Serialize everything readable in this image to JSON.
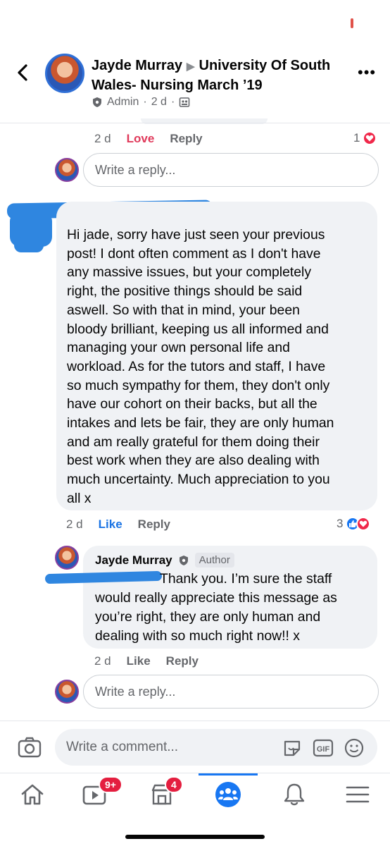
{
  "header": {
    "author": "Jayde Murray",
    "group": "University Of South Wales- Nursing March ’19",
    "role": "Admin",
    "time": "2 d",
    "more": "•••"
  },
  "first_actions": {
    "time": "2 d",
    "love": "Love",
    "reply": "Reply",
    "reaction_count": "1"
  },
  "reply_box_1": {
    "placeholder": "Write a reply..."
  },
  "comment": {
    "lines": [
      "Hi jade, sorry have just seen your previous",
      "post! I dont often comment as I don't have",
      "any massive issues, but your completely",
      "right, the positive things should be said",
      "aswell. So with that in mind, your been",
      "bloody brilliant, keeping us all informed and",
      "managing your own personal life and",
      "workload. As for the tutors and staff, I have",
      "so much sympathy for them, they don't only",
      "have our cohort on their backs, but all the",
      "intakes and lets be fair, they are only human",
      "and am really grateful for them doing their",
      "best work when they are also dealing with",
      "much uncertainty. Much appreciation to you",
      "all x"
    ],
    "time": "2 d",
    "like": "Like",
    "reply": "Reply",
    "reaction_count": "3"
  },
  "reply": {
    "author": "Jayde Murray",
    "badge": "Author",
    "lines": [
      "Thank you. I’m sure the staff",
      "would really appreciate this message as",
      "you’re right, they are only human and",
      "dealing with so much right now!! x"
    ],
    "time": "2 d",
    "like": "Like",
    "reply": "Reply"
  },
  "reply_box_2": {
    "placeholder": "Write a reply..."
  },
  "composer": {
    "placeholder": "Write a comment...",
    "gif": "GIF"
  },
  "tabs": {
    "video_badge": "9+",
    "marketplace_badge": "4"
  },
  "colors": {
    "accent": "#1877f2",
    "love": "#e0395a",
    "scribble": "#2f86e0"
  }
}
